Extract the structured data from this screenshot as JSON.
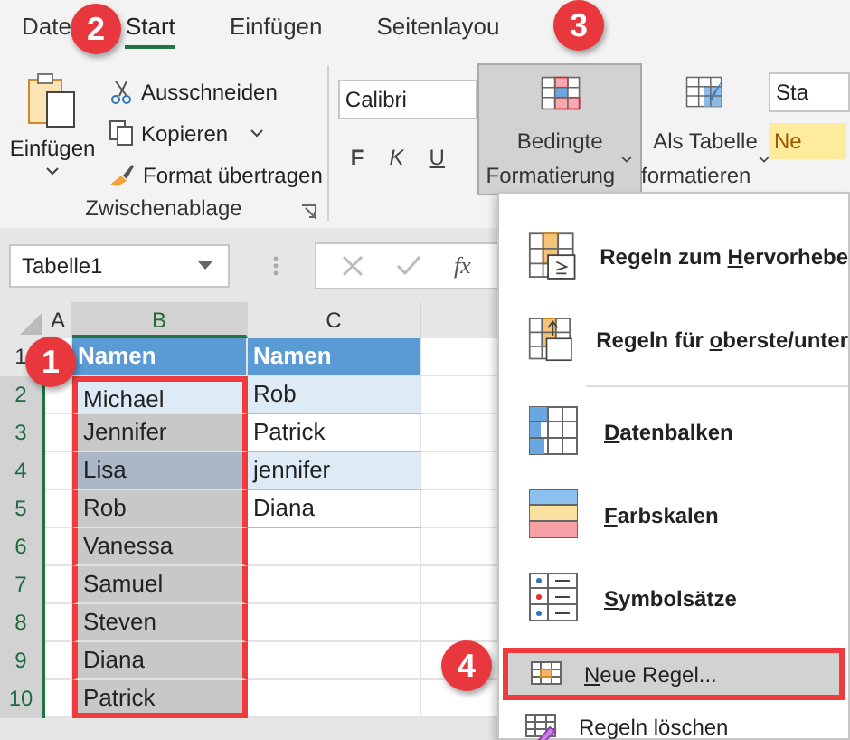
{
  "ribbon_tabs": [
    {
      "label": "Date",
      "selected": false
    },
    {
      "label": "Start",
      "selected": true
    },
    {
      "label": "Einfügen",
      "selected": false
    },
    {
      "label": "Seitenlayou",
      "selected": false
    }
  ],
  "clipboard": {
    "paste": "Einfügen",
    "group_label": "Zwischenablage",
    "actions": [
      {
        "label": "Ausschneiden",
        "dropdown": false
      },
      {
        "label": "Kopieren",
        "dropdown": true
      },
      {
        "label": "Format übertragen",
        "dropdown": false
      }
    ]
  },
  "font": {
    "name": "Calibri",
    "style_buttons": [
      "F",
      "K",
      "U"
    ]
  },
  "conditional_formatting": {
    "label_lines": [
      "Bedingte",
      "Formatierung"
    ],
    "pressed": true
  },
  "format_as_table": {
    "label_lines": [
      "Als Tabelle",
      "formatieren"
    ]
  },
  "styles": [
    "Sta",
    "Ne"
  ],
  "name_box": "Tabelle1",
  "formula_fx": "fx",
  "columns": [
    {
      "label": "A",
      "selected": false
    },
    {
      "label": "B",
      "selected": true
    },
    {
      "label": "C",
      "selected": false
    }
  ],
  "rows": [
    {
      "number": "1",
      "kind": "header",
      "b": "Namen",
      "c": "Namen",
      "selected": false
    },
    {
      "number": "2",
      "kind": "data",
      "b": "Michael",
      "c": "Rob",
      "selected": true
    },
    {
      "number": "3",
      "kind": "data",
      "b": "Jennifer",
      "c": "Patrick",
      "selected": true
    },
    {
      "number": "4",
      "kind": "data",
      "b": "Lisa",
      "c": "jennifer",
      "selected": true
    },
    {
      "number": "5",
      "kind": "data",
      "b": "Rob",
      "c": "Diana",
      "selected": true
    },
    {
      "number": "6",
      "kind": "data",
      "b": "Vanessa",
      "selected": true
    },
    {
      "number": "7",
      "kind": "data",
      "b": "Samuel",
      "selected": true
    },
    {
      "number": "8",
      "kind": "data",
      "b": "Steven",
      "selected": true
    },
    {
      "number": "9",
      "kind": "data",
      "b": "Diana",
      "selected": true
    },
    {
      "number": "10",
      "kind": "data",
      "b": "Patrick",
      "selected": true
    }
  ],
  "menu": [
    {
      "kind": "large",
      "start": "Regeln zum ",
      "key": "H",
      "end": "ervorhebe",
      "selected": false
    },
    {
      "kind": "large",
      "start": "Regeln für ",
      "key": "o",
      "end": "berste/unter",
      "selected": false
    },
    {
      "kind": "large",
      "key": "D",
      "end": "atenbalken",
      "selected": false
    },
    {
      "kind": "large",
      "key": "F",
      "end": "arbskalen",
      "selected": false
    },
    {
      "kind": "large",
      "key": "S",
      "end": "ymbolsätze",
      "selected": false
    },
    {
      "kind": "small",
      "key": "N",
      "end": "eue Regel...",
      "selected": true
    },
    {
      "kind": "small",
      "start": "Regeln löschen",
      "selected": false
    }
  ],
  "steps": [
    "1",
    "2",
    "3",
    "4"
  ]
}
